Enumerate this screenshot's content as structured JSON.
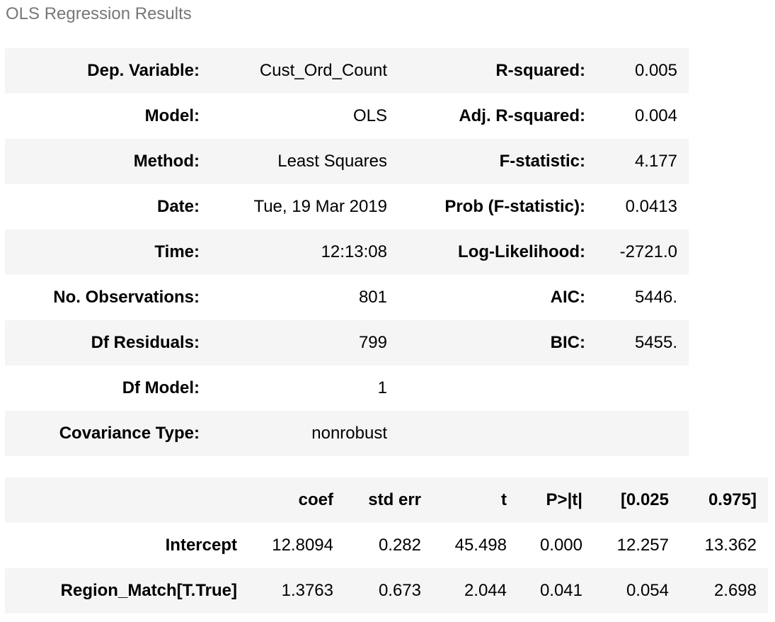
{
  "caption": "OLS Regression Results",
  "summary": {
    "rows": [
      {
        "label1": "Dep. Variable:",
        "value1": "Cust_Ord_Count",
        "label2": "R-squared:",
        "value2": "0.005"
      },
      {
        "label1": "Model:",
        "value1": "OLS",
        "label2": "Adj. R-squared:",
        "value2": "0.004"
      },
      {
        "label1": "Method:",
        "value1": "Least Squares",
        "label2": "F-statistic:",
        "value2": "4.177"
      },
      {
        "label1": "Date:",
        "value1": "Tue, 19 Mar 2019",
        "label2": "Prob (F-statistic):",
        "value2": "0.0413"
      },
      {
        "label1": "Time:",
        "value1": "12:13:08",
        "label2": "Log-Likelihood:",
        "value2": "-2721.0"
      },
      {
        "label1": "No. Observations:",
        "value1": "801",
        "label2": "AIC:",
        "value2": "5446."
      },
      {
        "label1": "Df Residuals:",
        "value1": "799",
        "label2": "BIC:",
        "value2": "5455."
      },
      {
        "label1": "Df Model:",
        "value1": "1",
        "label2": "",
        "value2": ""
      },
      {
        "label1": "Covariance Type:",
        "value1": "nonrobust",
        "label2": "",
        "value2": ""
      }
    ]
  },
  "coefficients": {
    "headers": [
      "",
      "coef",
      "std err",
      "t",
      "P>|t|",
      "[0.025",
      "0.975]"
    ],
    "rows": [
      {
        "name": "Intercept",
        "values": [
          "12.8094",
          "0.282",
          "45.498",
          "0.000",
          "12.257",
          "13.362"
        ]
      },
      {
        "name": "Region_Match[T.True]",
        "values": [
          "1.3763",
          "0.673",
          "2.044",
          "0.041",
          "0.054",
          "2.698"
        ]
      }
    ]
  }
}
